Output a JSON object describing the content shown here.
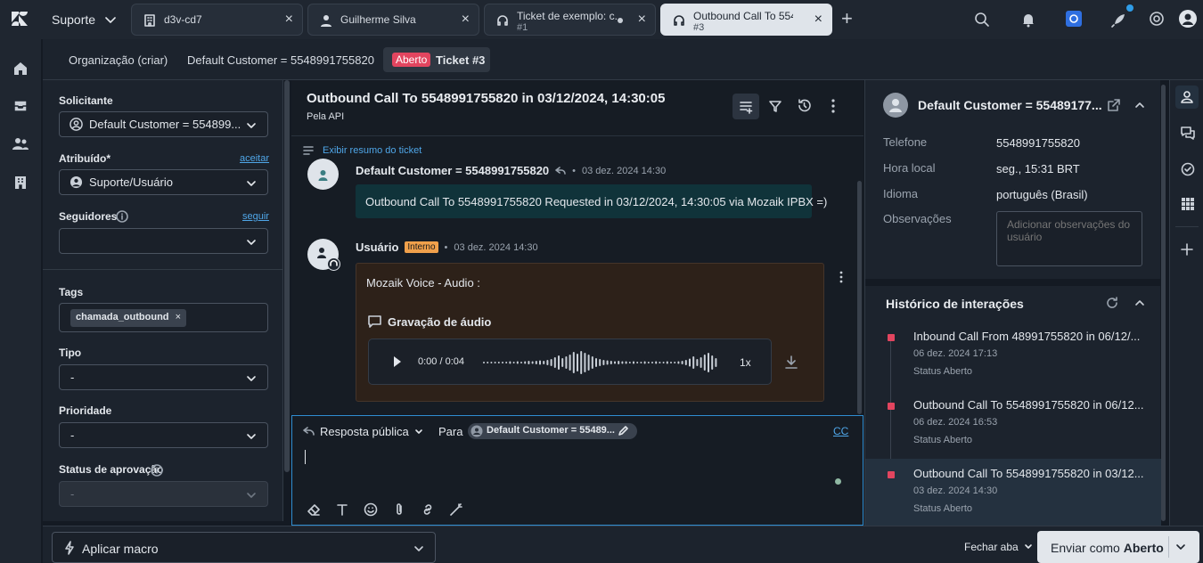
{
  "topbar": {
    "workspace": "Suporte",
    "tabs": [
      {
        "title": "d3v-cd7",
        "subtitle": ""
      },
      {
        "title": "Guilherme Silva",
        "subtitle": ""
      },
      {
        "title": "Ticket de exemplo: c...",
        "subtitle": "#1"
      },
      {
        "title": "Outbound Call To 554...",
        "subtitle": "#3"
      }
    ],
    "add_tab": "+"
  },
  "subheader": {
    "org": "Organização (criar)",
    "customer": "Default Customer = 5548991755820",
    "status_badge": "Aberto",
    "ticket": "Ticket #3"
  },
  "props": {
    "requester_label": "Solicitante",
    "requester_value": "Default Customer = 554899...",
    "assignee_label": "Atribuído*",
    "assignee_link": "aceitar",
    "assignee_value": "Suporte/Usuário",
    "followers_label": "Seguidores",
    "followers_link": "seguir",
    "followers_value": "",
    "tags_label": "Tags",
    "tag": "chamada_outbound",
    "tag_remove": "×",
    "type_label": "Tipo",
    "type_value": "-",
    "priority_label": "Prioridade",
    "priority_value": "-",
    "approval_label": "Status de aprovação",
    "approval_value": "-"
  },
  "conversation": {
    "title": "Outbound Call To 5548991755820 in 03/12/2024, 14:30:05",
    "via": "Pela API",
    "summary_link": "Exibir resumo do ticket",
    "msg1": {
      "author": "Default Customer = 5548991755820",
      "sep": "•",
      "time": "03 dez. 2024 14:30",
      "text": "Outbound Call To 5548991755820 Requested in 03/12/2024, 14:30:05 via Mozaik IPBX =)"
    },
    "msg2": {
      "author": "Usuário",
      "badge": "Interno",
      "sep": "•",
      "time": "03 dez. 2024 14:30",
      "text": "Mozaik Voice - Audio :",
      "audio_title": "Gravação de áudio",
      "audio_time": "0:00 / 0:04",
      "speed": "1x"
    }
  },
  "composer": {
    "reply_type": "Resposta pública",
    "to_label": "Para",
    "recipient": "Default Customer = 55489...",
    "cc": "CC"
  },
  "customer_panel": {
    "name": "Default Customer = 55489177...",
    "phone_label": "Telefone",
    "phone": "5548991755820",
    "localtime_label": "Hora local",
    "localtime": "seg., 15:31 BRT",
    "language_label": "Idioma",
    "language": "português (Brasil)",
    "notes_label": "Observações",
    "notes_placeholder": "Adicionar observações do usuário",
    "history_title": "Histórico de interações",
    "history": [
      {
        "title": "Inbound Call From 48991755820 in 06/12/...",
        "date": "06 dez. 2024 17:13",
        "status": "Status Aberto"
      },
      {
        "title": "Outbound Call To 5548991755820 in 06/12...",
        "date": "06 dez. 2024 16:53",
        "status": "Status Aberto"
      },
      {
        "title": "Outbound Call To 5548991755820 in 03/12...",
        "date": "03 dez. 2024 14:30",
        "status": "Status Aberto"
      }
    ]
  },
  "footer": {
    "macro": "Aplicar macro",
    "close_tab": "Fechar aba",
    "submit_prefix": "Enviar como",
    "submit_status": "Aberto"
  },
  "colors": {
    "accent": "#2f8dd1",
    "status_open": "#e2455f",
    "internal_bg": "#2d2119",
    "internal_badge": "#f0a04b"
  }
}
